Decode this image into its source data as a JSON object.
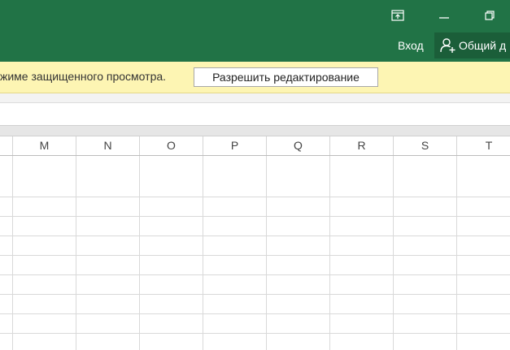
{
  "theme": {
    "accent": "#217346",
    "accent_dark": "#1b5e39",
    "message_bar_bg": "#fdf5b3"
  },
  "titlebar": {
    "icons": [
      "ribbon-display-options-icon",
      "minimize-icon",
      "restore-icon"
    ],
    "signin_label": "Вход",
    "share_label": "Общий д",
    "share_icon": "person-add-icon"
  },
  "message_bar": {
    "text": "жиме защищенного просмотра.",
    "enable_editing_label": "Разрешить редактирование"
  },
  "sheet": {
    "columns": [
      "M",
      "N",
      "O",
      "P",
      "Q",
      "R",
      "S",
      "T"
    ]
  }
}
